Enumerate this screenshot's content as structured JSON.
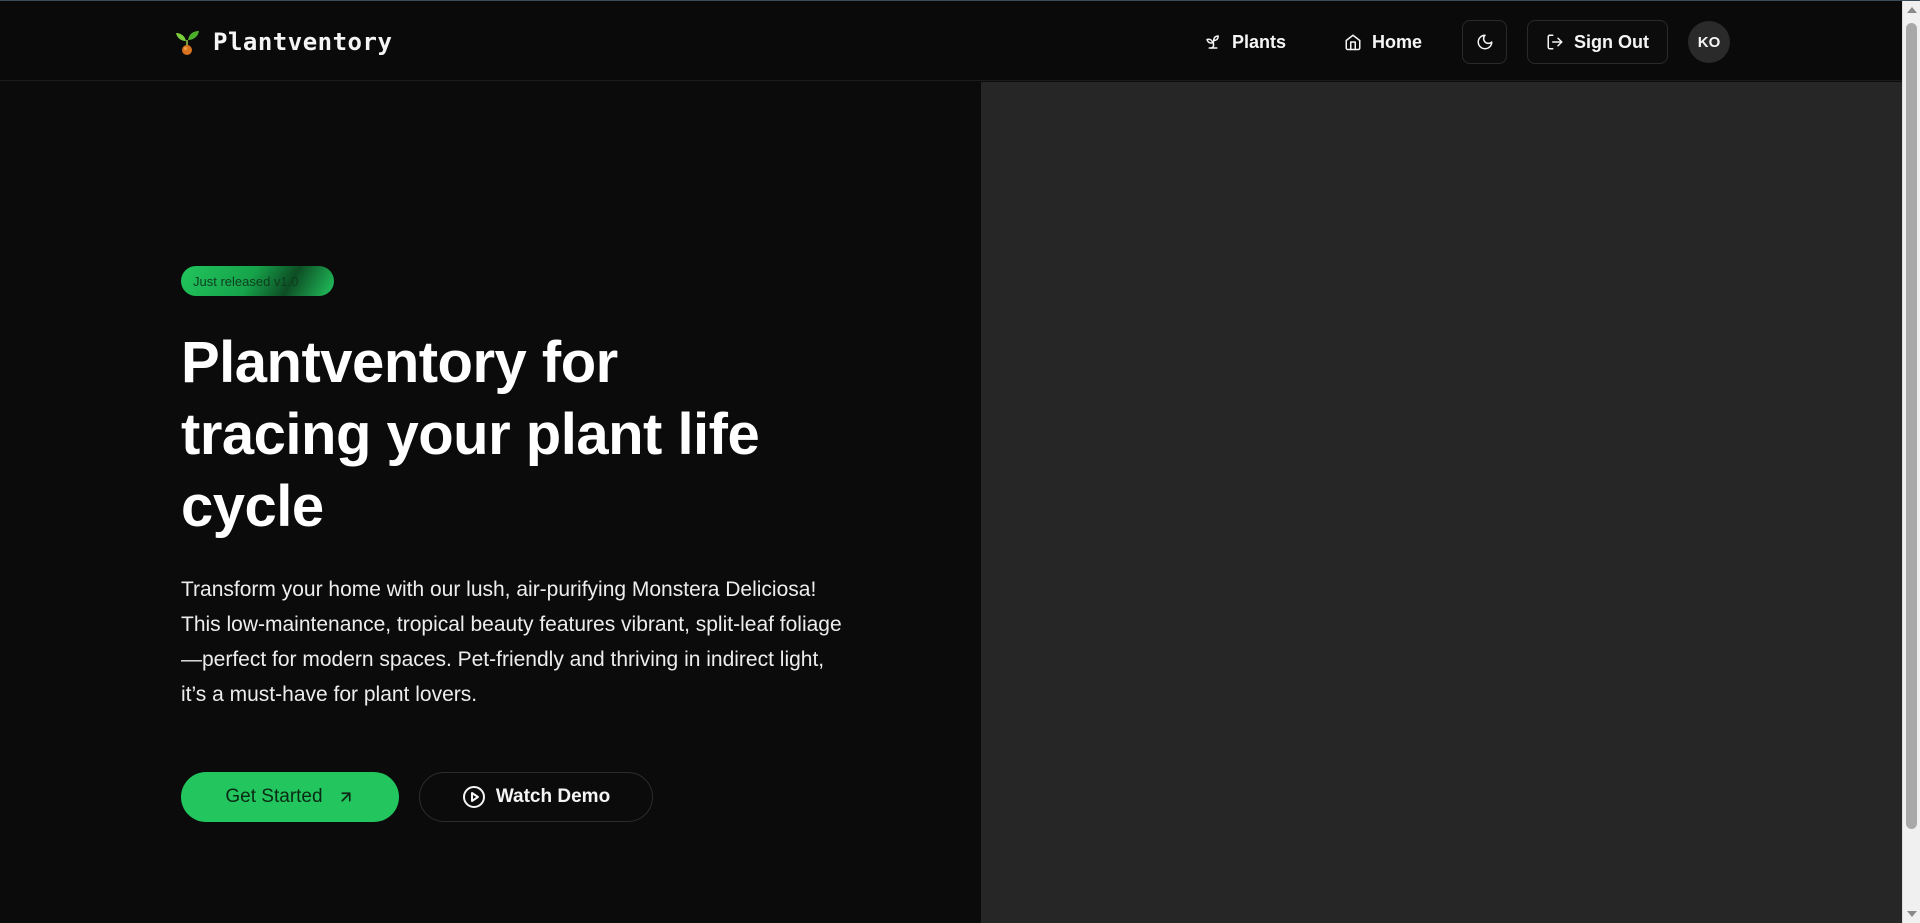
{
  "navbar": {
    "brand_name": "Plantventory",
    "brand_icon": "sprout-icon",
    "links": [
      {
        "label": "Plants",
        "icon": "sprout-icon"
      },
      {
        "label": "Home",
        "icon": "home-icon"
      }
    ],
    "theme_toggle_icon": "moon-icon",
    "sign_out_label": "Sign Out",
    "sign_out_icon": "log-out-icon",
    "avatar_initials": "KO"
  },
  "hero": {
    "badge_text": "Just released v1.0",
    "title_lines": [
      "Plantventory for",
      "tracing your plant life",
      "cycle"
    ],
    "description_lines": [
      "Transform your home with our lush, air-purifying Monstera Deliciosa!",
      "This low-maintenance, tropical beauty features vibrant, split-leaf foliage",
      "—perfect for modern spaces. Pet-friendly and thriving in indirect light,",
      "it’s a must-have for plant lovers."
    ],
    "primary_cta": "Get Started",
    "primary_cta_icon": "arrow-up-right-icon",
    "secondary_cta": "Watch Demo",
    "secondary_cta_icon": "play-circle-icon"
  },
  "colors": {
    "accent": "#22c55e",
    "background": "#0b0b0b",
    "panel": "#262626"
  }
}
